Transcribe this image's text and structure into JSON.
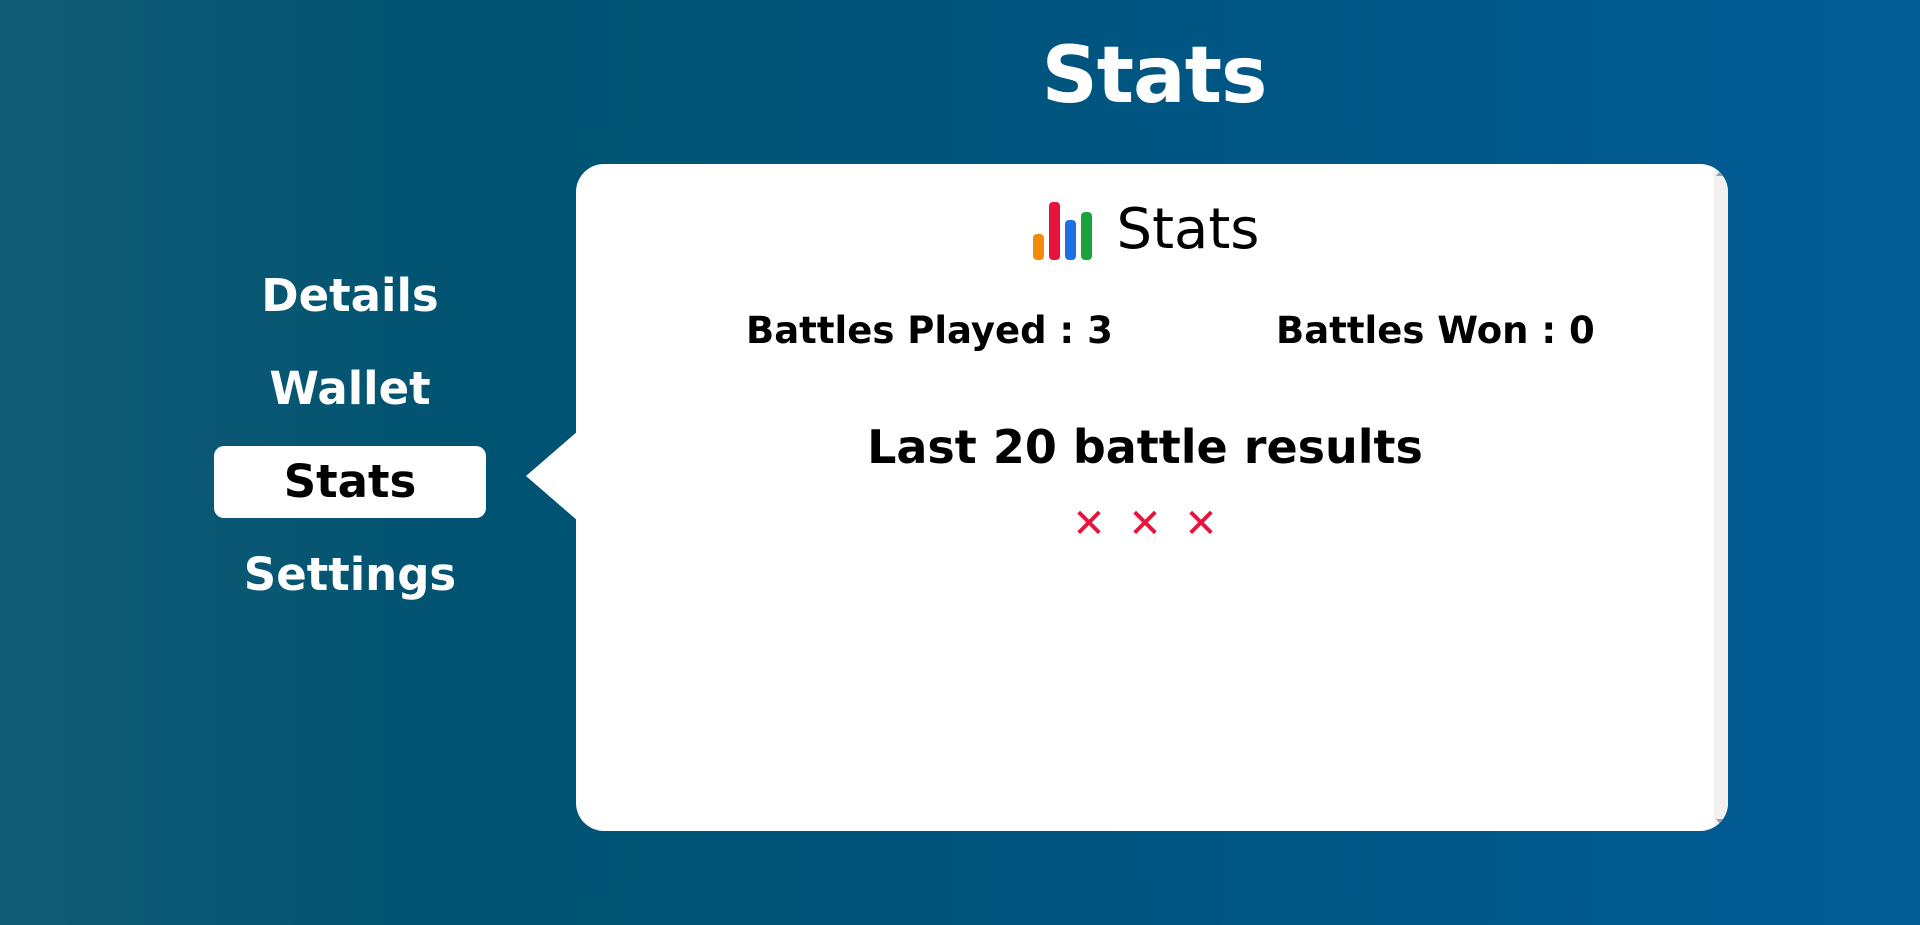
{
  "header": {
    "title": "Stats"
  },
  "nav": {
    "items": [
      {
        "label": "Details",
        "active": false
      },
      {
        "label": "Wallet",
        "active": false
      },
      {
        "label": "Stats",
        "active": true
      },
      {
        "label": "Settings",
        "active": false
      }
    ]
  },
  "panel": {
    "title": "Stats",
    "icon": "bar-chart-icon",
    "battles_played": "Battles Played : 3",
    "battles_won": "Battles Won : 0",
    "results_heading": "Last 20 battle results",
    "results": [
      {
        "outcome": "loss",
        "symbol": "✕"
      },
      {
        "outcome": "loss",
        "symbol": "✕"
      },
      {
        "outcome": "loss",
        "symbol": "✕"
      }
    ]
  },
  "colors": {
    "background_start": "#115b75",
    "background_end": "#015c96",
    "loss": "#e8133a",
    "icon_bars": [
      "#f58a07",
      "#e8133a",
      "#1d6fe3",
      "#19a33c"
    ]
  }
}
